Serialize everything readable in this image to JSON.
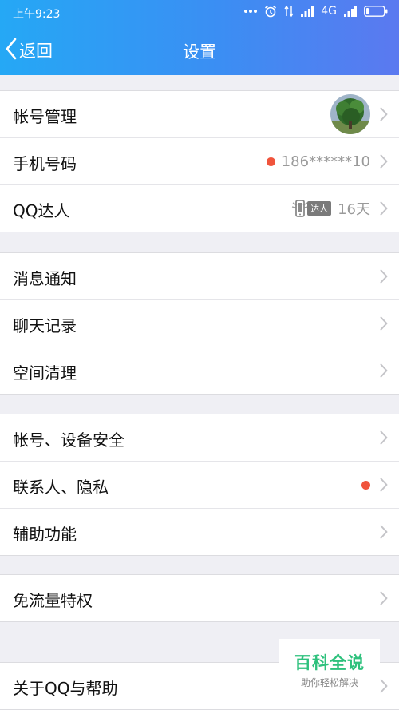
{
  "status_bar": {
    "time": "上午9:23",
    "network": "4G"
  },
  "nav": {
    "back_label": "返回",
    "title": "设置"
  },
  "groups": [
    {
      "rows": [
        {
          "label": "帐号管理"
        },
        {
          "label": "手机号码",
          "value": "186******10"
        },
        {
          "label": "QQ达人",
          "badge": "达人",
          "value": "16天"
        }
      ]
    },
    {
      "rows": [
        {
          "label": "消息通知"
        },
        {
          "label": "聊天记录"
        },
        {
          "label": "空间清理"
        }
      ]
    },
    {
      "rows": [
        {
          "label": "帐号、设备安全"
        },
        {
          "label": "联系人、隐私"
        },
        {
          "label": "辅助功能"
        }
      ]
    },
    {
      "rows": [
        {
          "label": "免流量特权"
        }
      ]
    },
    {
      "rows": [
        {
          "label": "关于QQ与帮助"
        }
      ]
    }
  ],
  "watermark": {
    "title": "百科全说",
    "subtitle": "助你轻松解决"
  },
  "colors": {
    "header_start": "#25a8f5",
    "header_end": "#5b79f0",
    "red_dot": "#f0543c",
    "watermark_green": "#2ec17d"
  }
}
